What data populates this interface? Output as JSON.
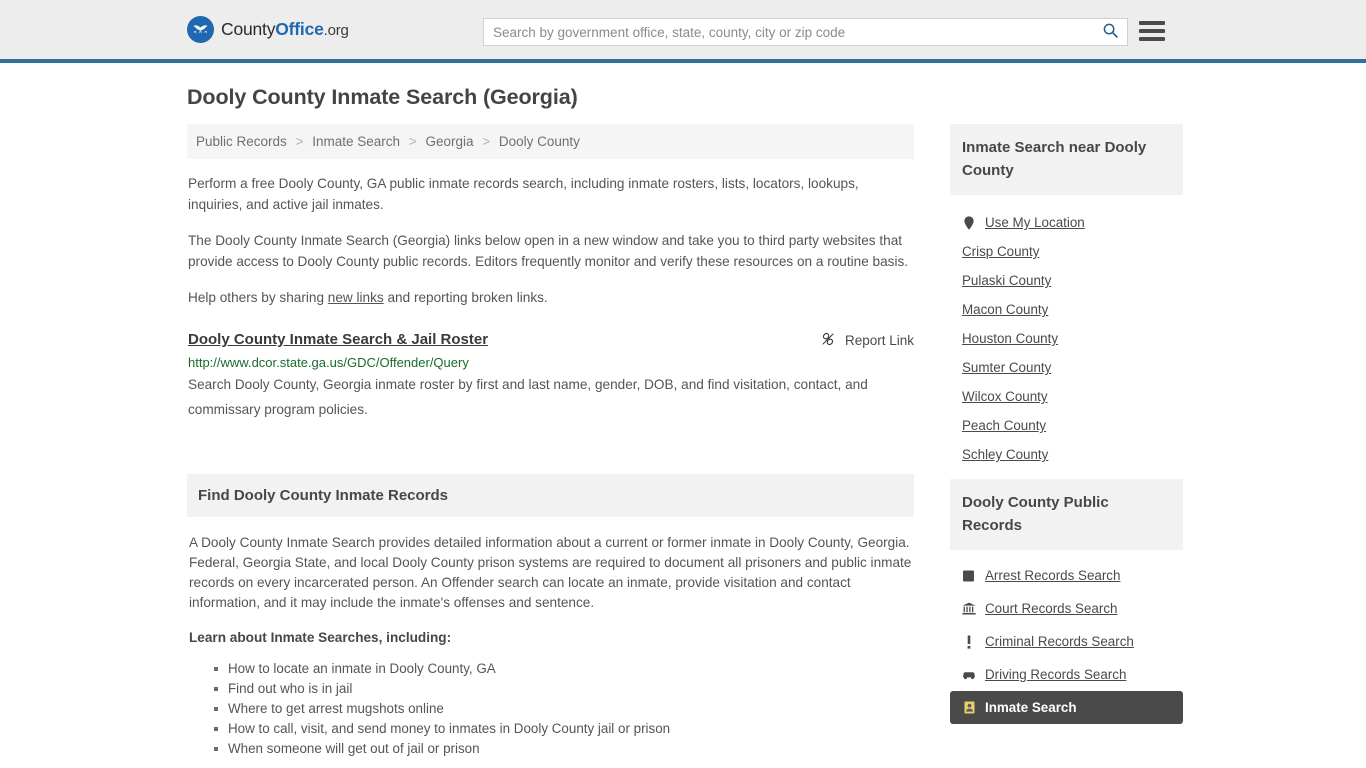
{
  "header": {
    "logo": {
      "part1": "County",
      "part2": "Office",
      "part3": ".org",
      "icon": "eagle-shield-icon"
    },
    "search": {
      "placeholder": "Search by government office, state, county, city or zip code",
      "value": "",
      "icon": "search-icon"
    },
    "menu_icon": "hamburger-menu-icon",
    "accent_color": "#31719c",
    "background_color": "#ededed"
  },
  "page": {
    "title": "Dooly County Inmate Search (Georgia)"
  },
  "breadcrumb": {
    "items": [
      {
        "label": "Public Records"
      },
      {
        "label": "Inmate Search"
      },
      {
        "label": "Georgia"
      },
      {
        "label": "Dooly County"
      }
    ],
    "separator": ">"
  },
  "intro": {
    "paragraph1": "Perform a free Dooly County, GA public inmate records search, including inmate rosters, lists, locators, lookups, inquiries, and active jail inmates.",
    "paragraph2": "The Dooly County Inmate Search (Georgia) links below open in a new window and take you to third party websites that provide access to Dooly County public records. Editors frequently monitor and verify these resources on a routine basis.",
    "paragraph3_before": "Help others by sharing ",
    "paragraph3_link": "new links",
    "paragraph3_after": " and reporting broken links."
  },
  "result": {
    "title": "Dooly County Inmate Search & Jail Roster",
    "url": "http://www.dcor.state.ga.us/GDC/Offender/Query",
    "description": "Search Dooly County, Georgia inmate roster by first and last name, gender, DOB, and find visitation, contact, and commissary program policies.",
    "report_label": "Report Link",
    "report_icon": "broken-link-icon",
    "url_color": "#1a6b2a"
  },
  "records_section": {
    "heading": "Find Dooly County Inmate Records",
    "paragraph": "A Dooly County Inmate Search provides detailed information about a current or former inmate in Dooly County, Georgia. Federal, Georgia State, and local Dooly County prison systems are required to document all prisoners and public inmate records on every incarcerated person. An Offender search can locate an inmate, provide visitation and contact information, and it may include the inmate's offenses and sentence.",
    "learn_label": "Learn about Inmate Searches, including:",
    "learn_items": [
      "How to locate an inmate in Dooly County, GA",
      "Find out who is in jail",
      "Where to get arrest mugshots online",
      "How to call, visit, and send money to inmates in Dooly County jail or prison",
      "When someone will get out of jail or prison"
    ]
  },
  "sidebar": {
    "nearby": {
      "heading": "Inmate Search near Dooly County",
      "items": [
        {
          "label": "Use My Location",
          "icon": "map-pin-icon",
          "active": false
        },
        {
          "label": "Crisp County",
          "icon": "",
          "active": false
        },
        {
          "label": "Pulaski County",
          "icon": "",
          "active": false
        },
        {
          "label": "Macon County",
          "icon": "",
          "active": false
        },
        {
          "label": "Houston County",
          "icon": "",
          "active": false
        },
        {
          "label": "Sumter County",
          "icon": "",
          "active": false
        },
        {
          "label": "Wilcox County",
          "icon": "",
          "active": false
        },
        {
          "label": "Peach County",
          "icon": "",
          "active": false
        },
        {
          "label": "Schley County",
          "icon": "",
          "active": false
        }
      ]
    },
    "public_records": {
      "heading": "Dooly County Public Records",
      "items": [
        {
          "label": "Arrest Records Search",
          "icon": "fingerprint-square-icon",
          "active": false
        },
        {
          "label": "Court Records Search",
          "icon": "courthouse-icon",
          "active": false
        },
        {
          "label": "Criminal Records Search",
          "icon": "exclamation-icon",
          "active": false
        },
        {
          "label": "Driving Records Search",
          "icon": "car-icon",
          "active": false
        },
        {
          "label": "Inmate Search",
          "icon": "inmate-id-icon",
          "active": true
        }
      ],
      "active_bg": "#4a4a4a"
    }
  }
}
